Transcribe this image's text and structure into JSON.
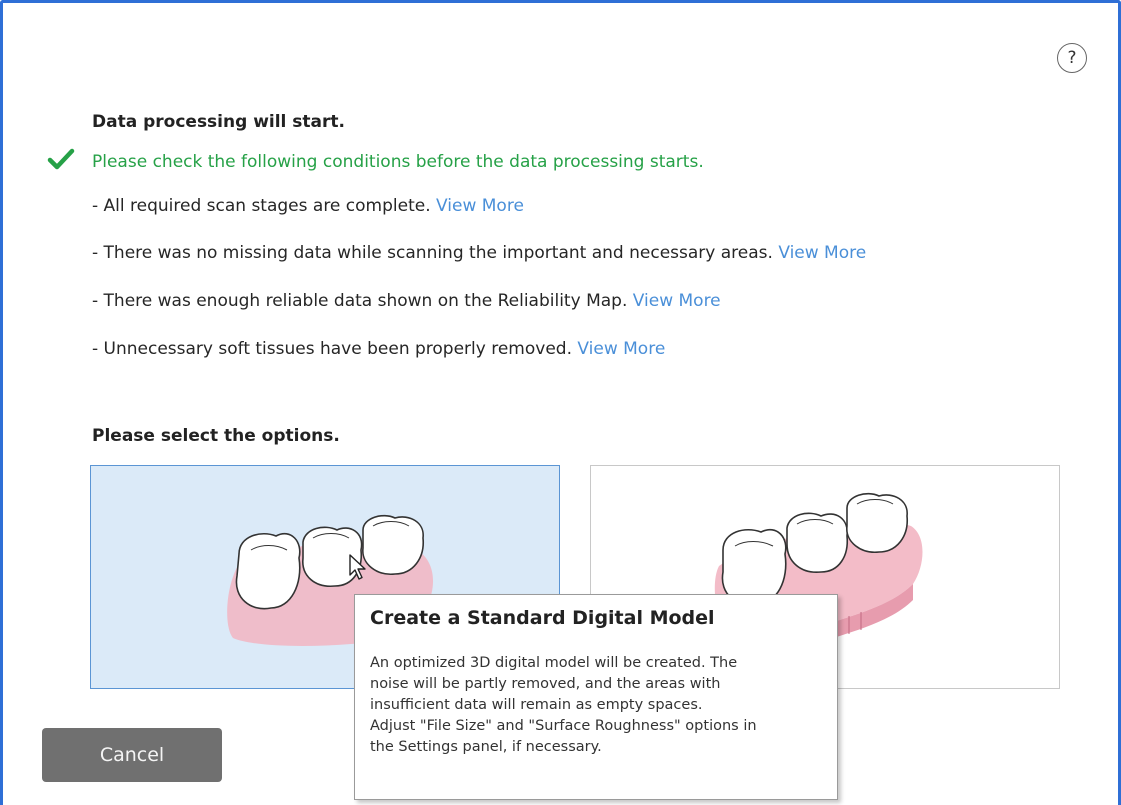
{
  "help": {
    "label": "?"
  },
  "header": {
    "title": "Data processing will start."
  },
  "check": {
    "text": "Please check the following conditions before the data processing starts.",
    "color": "#26a147"
  },
  "conditions": [
    {
      "text": "- All required scan stages are complete.",
      "link": "View More"
    },
    {
      "text": "- There was no missing data while scanning the important and necessary areas.",
      "link": "View More"
    },
    {
      "text": "- There was enough reliable data shown on the Reliability Map.",
      "link": "View More"
    },
    {
      "text": "- Unnecessary soft tissues have been properly removed.",
      "link": "View More"
    }
  ],
  "options": {
    "title": "Please select the options.",
    "cards": [
      {
        "icon": "teeth-model-icon",
        "selected": true
      },
      {
        "icon": "teeth-model-with-base-icon",
        "selected": false
      }
    ]
  },
  "tooltip": {
    "title": "Create a Standard Digital Model",
    "lines": [
      "An optimized 3D digital model will be created. The",
      "noise will be partly removed, and the areas with",
      "insufficient data will remain as empty spaces.",
      "Adjust \"File Size\" and \"Surface Roughness\" options in",
      "the Settings panel, if necessary."
    ]
  },
  "footer": {
    "cancel_label": "Cancel"
  },
  "colors": {
    "accent": "#2f6fd6",
    "link": "#4a8fd8",
    "selected_bg": "#dbeaf8",
    "gum": "#f2b5c2"
  }
}
